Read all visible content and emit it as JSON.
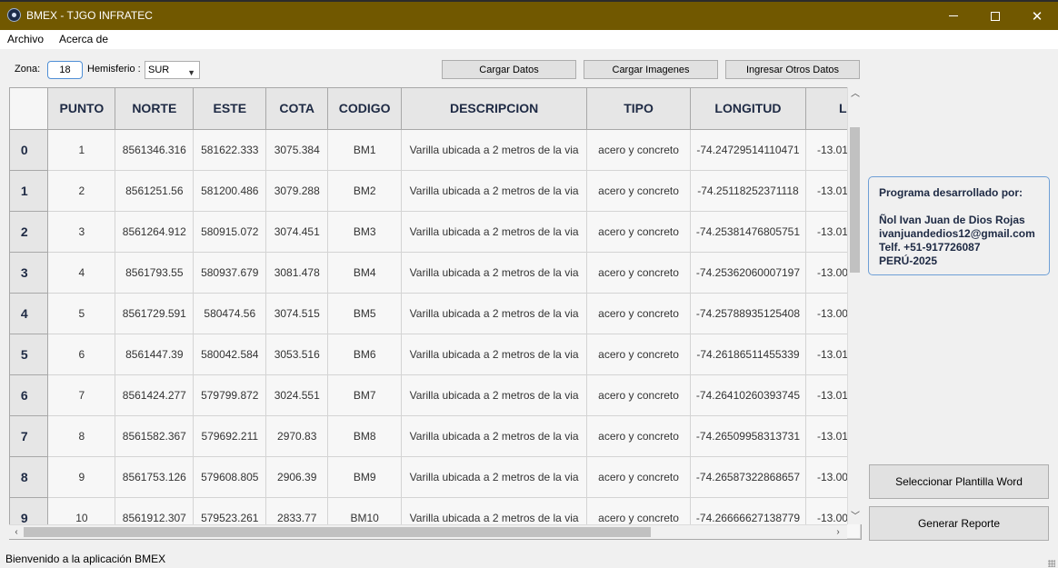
{
  "window": {
    "title": "BMEX - TJGO INFRATEC",
    "close_glyph": "✕"
  },
  "menu": {
    "items": [
      "Archivo",
      "Acerca de"
    ]
  },
  "toolbar": {
    "zona_label": "Zona:",
    "zona_value": "18",
    "hemisferio_label": "Hemisferio :",
    "hemisferio_value": "SUR",
    "cargar_datos": "Cargar Datos",
    "cargar_imagenes": "Cargar Imagenes",
    "ingresar_otros_datos": "Ingresar Otros Datos"
  },
  "table": {
    "columns": [
      "PUNTO",
      "NORTE",
      "ESTE",
      "COTA",
      "CODIGO",
      "DESCRIPCION",
      "TIPO",
      "LONGITUD",
      "L"
    ],
    "rows": [
      {
        "index": "0",
        "cells": [
          "1",
          "8561346.316",
          "581622.333",
          "3075.384",
          "BM1",
          "Varilla ubicada a 2 metros de la via",
          "acero y concreto",
          "-74.24729514110471",
          "-13.01"
        ]
      },
      {
        "index": "1",
        "cells": [
          "2",
          "8561251.56",
          "581200.486",
          "3079.288",
          "BM2",
          "Varilla ubicada a 2 metros de la via",
          "acero y concreto",
          "-74.25118252371118",
          "-13.01"
        ]
      },
      {
        "index": "2",
        "cells": [
          "3",
          "8561264.912",
          "580915.072",
          "3074.451",
          "BM3",
          "Varilla ubicada a 2 metros de la via",
          "acero y concreto",
          "-74.25381476805751",
          "-13.01"
        ]
      },
      {
        "index": "3",
        "cells": [
          "4",
          "8561793.55",
          "580937.679",
          "3081.478",
          "BM4",
          "Varilla ubicada a 2 metros de la via",
          "acero y concreto",
          "-74.25362060007197",
          "-13.00"
        ]
      },
      {
        "index": "4",
        "cells": [
          "5",
          "8561729.591",
          "580474.56",
          "3074.515",
          "BM5",
          "Varilla ubicada a 2 metros de la via",
          "acero y concreto",
          "-74.25788935125408",
          "-13.00"
        ]
      },
      {
        "index": "5",
        "cells": [
          "6",
          "8561447.39",
          "580042.584",
          "3053.516",
          "BM6",
          "Varilla ubicada a 2 metros de la via",
          "acero y concreto",
          "-74.26186511455339",
          "-13.01"
        ]
      },
      {
        "index": "6",
        "cells": [
          "7",
          "8561424.277",
          "579799.872",
          "3024.551",
          "BM7",
          "Varilla ubicada a 2 metros de la via",
          "acero y concreto",
          "-74.26410260393745",
          "-13.01"
        ]
      },
      {
        "index": "7",
        "cells": [
          "8",
          "8561582.367",
          "579692.211",
          "2970.83",
          "BM8",
          "Varilla ubicada a 2 metros de la via",
          "acero y concreto",
          "-74.26509958313731",
          "-13.01"
        ]
      },
      {
        "index": "8",
        "cells": [
          "9",
          "8561753.126",
          "579608.805",
          "2906.39",
          "BM9",
          "Varilla ubicada a 2 metros de la via",
          "acero y concreto",
          "-74.26587322868657",
          "-13.00"
        ]
      },
      {
        "index": "9",
        "cells": [
          "10",
          "8561912.307",
          "579523.261",
          "2833.77",
          "BM10",
          "Varilla ubicada a 2 metros de la via",
          "acero y concreto",
          "-74.26666627138779",
          "-13.00"
        ]
      }
    ]
  },
  "credits": {
    "heading": "Programa desarrollado por:",
    "name": "Ñol Ivan Juan de Dios Rojas",
    "email": "ivanjuandedios12@gmail.com",
    "phone": "Telf. +51-917726087",
    "country_year": "PERÚ-2025"
  },
  "actions": {
    "seleccionar_plantilla": "Seleccionar Plantilla Word",
    "generar_reporte": "Generar Reporte"
  },
  "status": {
    "message": "Bienvenido a la aplicación BMEX"
  },
  "colors": {
    "titlebar": "#715800",
    "accent": "#4f8fd6"
  }
}
